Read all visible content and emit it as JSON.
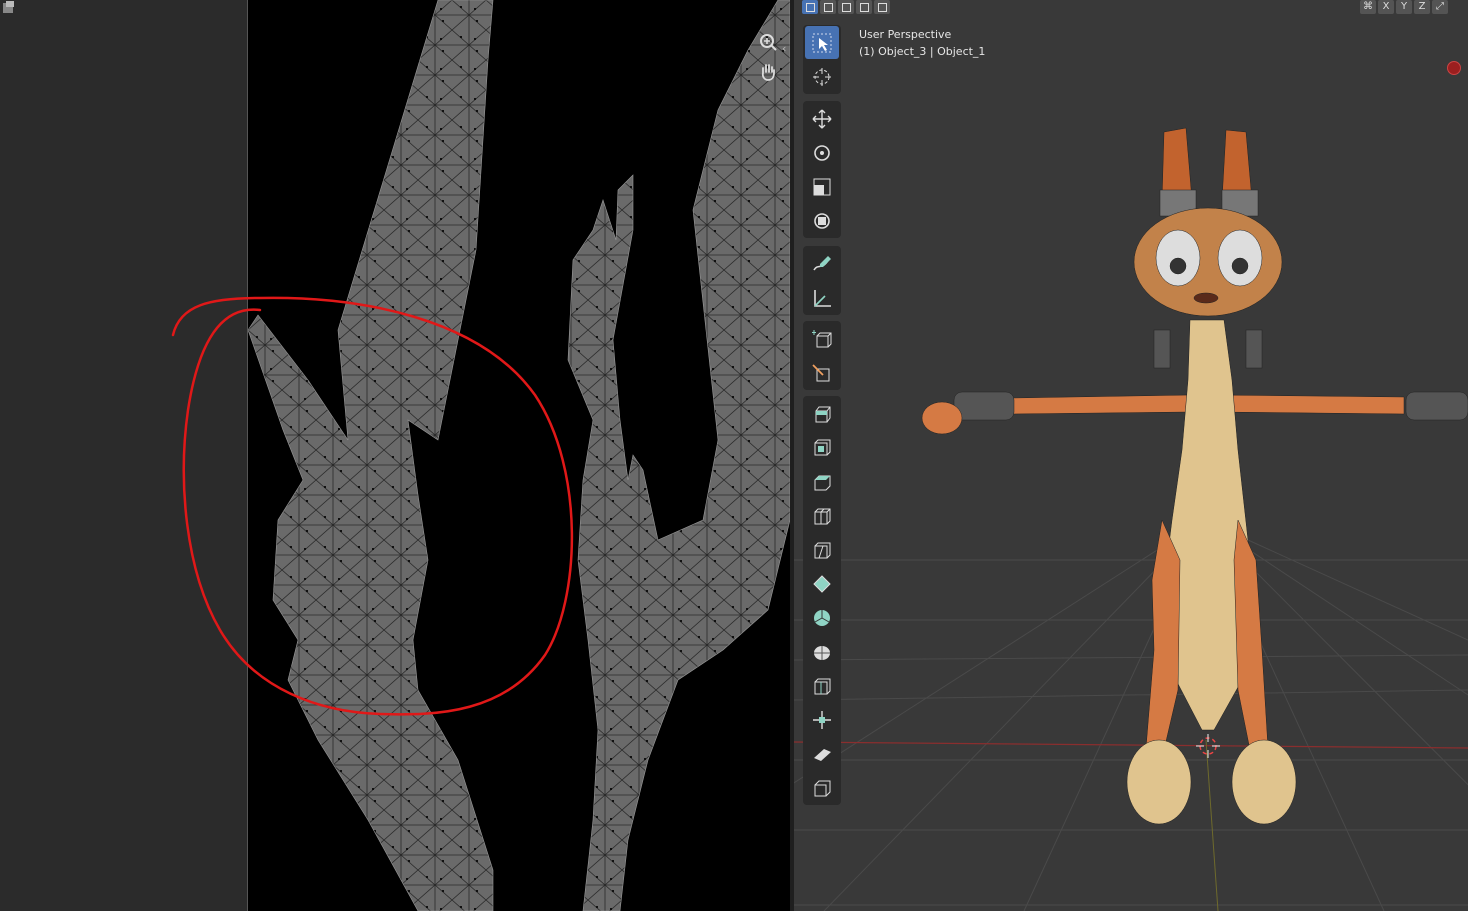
{
  "viewport": {
    "title": "User Perspective",
    "subtitle": "(1) Object_3 | Object_1",
    "axes": [
      "X",
      "Y",
      "Z"
    ]
  },
  "colors": {
    "uv_background": "#000000",
    "uv_faces": "#6a6a6a",
    "viewport_background": "#393939",
    "active_tool": "#4772b3",
    "annotation": "#e01818",
    "x_axis": "#a83232"
  },
  "toolbar": {
    "tools": [
      "select-box-icon",
      "cursor-icon",
      "move-icon",
      "rotate-icon",
      "scale-icon",
      "transform-icon",
      "annotate-icon",
      "measure-icon",
      "add-cube-icon",
      "knife-project-icon",
      "extrude-icon",
      "inset-icon",
      "bevel-icon",
      "loop-cut-icon",
      "knife-icon",
      "poly-build-icon",
      "spin-icon",
      "smooth-icon",
      "edge-slide-icon",
      "shrink-fatten-icon",
      "shear-icon",
      "rip-icon"
    ]
  }
}
